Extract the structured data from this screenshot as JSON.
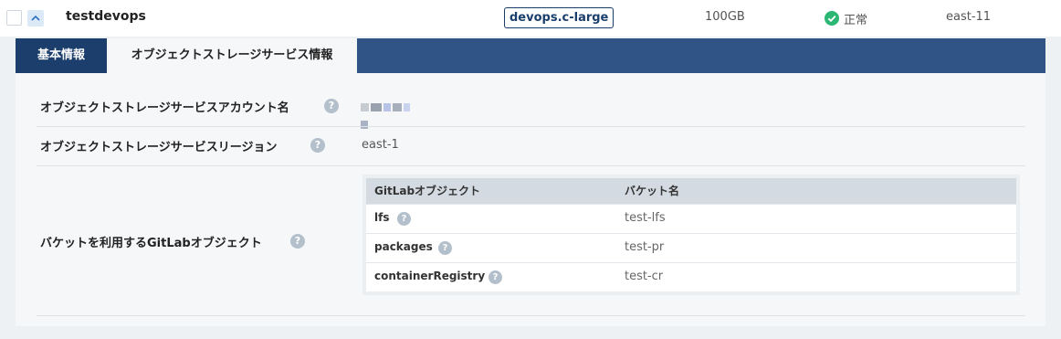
{
  "row": {
    "name": "testdevops",
    "plan": "devops.c-large",
    "capacity": "100GB",
    "status": "正常",
    "region": "east-11",
    "toggle_icon": "chevron-up-icon",
    "status_icon": "check-circle-icon",
    "status_color": "#2bb673"
  },
  "tabs": [
    {
      "label": "基本情報"
    },
    {
      "label": "オブジェクトストレージサービス情報"
    }
  ],
  "details": {
    "account_label": "オブジェクトストレージサービスアカウント名",
    "region_label": "オブジェクトストレージサービスリージョン",
    "region_value": "east-1",
    "objects_label": "バケットを利用するGitLabオブジェクト",
    "help_glyph": "?"
  },
  "objects_table": {
    "headers": [
      "GitLabオブジェクト",
      "バケット名"
    ],
    "rows": [
      {
        "object": "lfs",
        "bucket": "test-lfs"
      },
      {
        "object": "packages",
        "bucket": "test-pr"
      },
      {
        "object": "containerRegistry",
        "bucket": "test-cr"
      }
    ]
  }
}
